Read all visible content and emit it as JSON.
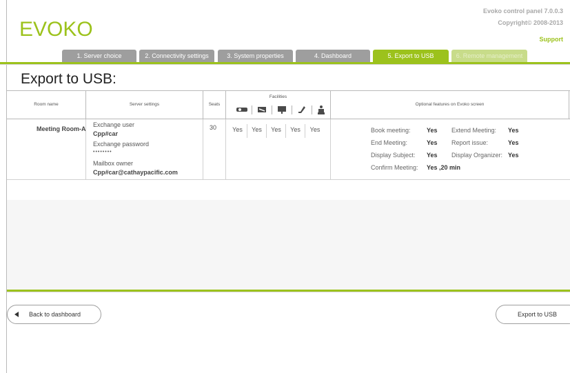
{
  "header": {
    "logo_text": "EVOKO",
    "version": "Evoko control panel 7.0.0.3",
    "copyright": "Copyright© 2008-2013",
    "support_link": "Support"
  },
  "tabs": [
    {
      "label": "1. Server choice",
      "state": "inactive"
    },
    {
      "label": "2. Connectivity settings",
      "state": "inactive"
    },
    {
      "label": "3. System properties",
      "state": "inactive"
    },
    {
      "label": "4. Dashboard",
      "state": "inactive"
    },
    {
      "label": "5. Export to USB",
      "state": "active"
    },
    {
      "label": "6. Remote management",
      "state": "disabled"
    }
  ],
  "page": {
    "title": "Export to USB:"
  },
  "table": {
    "headers": {
      "room_name": "Room name",
      "server_settings": "Server settings",
      "seats": "Seats",
      "facilities": "Facilities",
      "optional_features": "Optional features on Evoko screen"
    },
    "facility_icons": [
      "projector-icon",
      "whiteboard-icon",
      "display-icon",
      "phone-icon",
      "accessibility-icon"
    ],
    "row": {
      "room_name": "Meeting Room-A",
      "exchange_user_label": "Exchange user",
      "exchange_user_value": "Cpp#car",
      "exchange_password_label": "Exchange password",
      "exchange_password_value": "••••••••",
      "mailbox_owner_label": "Mailbox owner",
      "mailbox_owner_value": "Cpp#car@cathaypacific.com",
      "seats": "30",
      "facilities": [
        "Yes",
        "Yes",
        "Yes",
        "Yes",
        "Yes"
      ],
      "options": {
        "book_meeting_label": "Book meeting:",
        "book_meeting_value": "Yes",
        "extend_meeting_label": "Extend Meeting:",
        "extend_meeting_value": "Yes",
        "end_meeting_label": "End Meeting:",
        "end_meeting_value": "Yes",
        "report_issue_label": "Report issue:",
        "report_issue_value": "Yes",
        "display_subject_label": "Display Subject:",
        "display_subject_value": "Yes",
        "display_organizer_label": "Display Organizer:",
        "display_organizer_value": "Yes",
        "confirm_meeting_label": "Confirm Meeting:",
        "confirm_meeting_value": "Yes ,20 min"
      }
    }
  },
  "footer": {
    "back_button": "Back to dashboard",
    "export_button": "Export to USB"
  },
  "colors": {
    "accent_green": "#9cc21c",
    "tab_grey": "#9e9e9e",
    "tab_disabled": "#c8dc8a"
  }
}
